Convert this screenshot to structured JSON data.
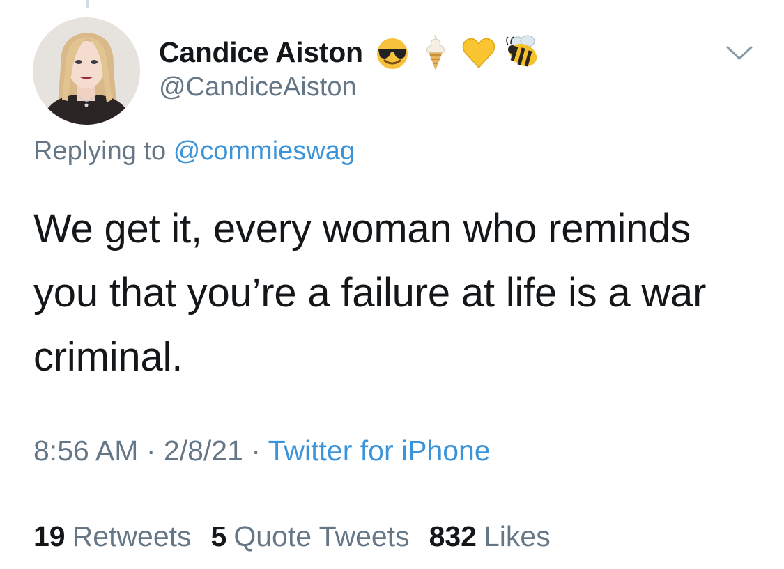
{
  "tweet": {
    "author": {
      "display_name": "Candice Aiston",
      "handle": "@CandiceAiston",
      "name_emojis": [
        "smiling-face-with-sunglasses",
        "soft-ice-cream",
        "yellow-heart",
        "honeybee"
      ]
    },
    "reply": {
      "prefix": "Replying to",
      "mention": "@commieswag"
    },
    "text": "We get it, every woman who reminds you that you’re a failure at life is a war criminal.",
    "meta": {
      "time": "8:56 AM",
      "date": "2/8/21",
      "separator": "·",
      "source": "Twitter for iPhone"
    },
    "stats": {
      "retweets_count": "19",
      "retweets_label": "Retweets",
      "quotes_count": "5",
      "quotes_label": "Quote Tweets",
      "likes_count": "832",
      "likes_label": "Likes"
    },
    "icons": {
      "menu": "chevron-down-icon"
    },
    "colors": {
      "link": "#3b94d9",
      "secondary_text": "#657786",
      "primary_text": "#14171a",
      "divider": "#d9dfe4"
    }
  }
}
